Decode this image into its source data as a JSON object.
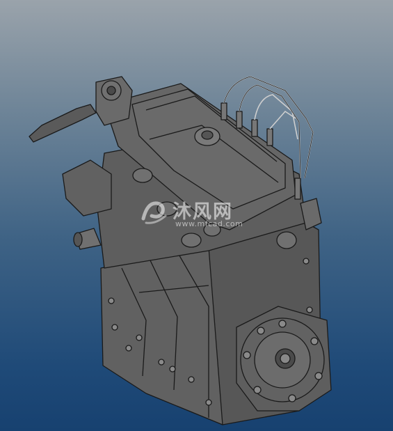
{
  "viewer": {
    "background_top": "#9aa3ab",
    "background_bottom": "#174170"
  },
  "model": {
    "part_color": "#5a5a5a",
    "edge_color": "#1a1a1a",
    "highlight_color": "#9a9a9a"
  },
  "watermark": {
    "logo_icon": "wave-logo-icon",
    "brand_text": "沐风网",
    "url_text": "www.mfcad.com"
  }
}
